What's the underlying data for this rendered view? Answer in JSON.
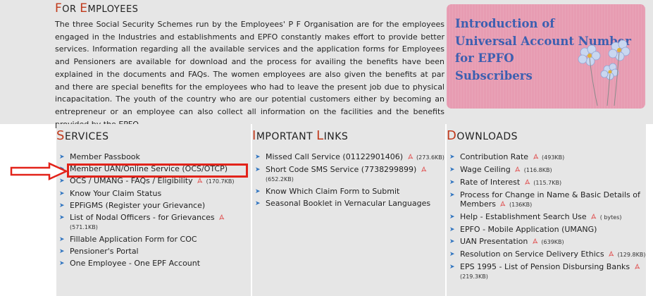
{
  "employees": {
    "title_first": "F",
    "title_rest_1": "OR ",
    "title_e": "E",
    "title_rest_2": "MPLOYEES",
    "text": "The three Social Security Schemes run by the Employees' P F Organisation are for the employees engaged in the Industries and establishments and EPFO constantly makes effort to provide better services. Information regarding all the available services and the application forms for Employees and Pensioners are available for download and the process for availing the benefits have been explained in the documents and FAQs. The women employees are also given the benefits at par and there are special benefits for the employees who had to leave the present job due to physical incapacitation. The youth of the country who are our potential customers either by becoming an entrepreneur or an employee can also collect all information on the facilities and the benefits provided by the EPFO."
  },
  "banner": {
    "line1": "Introduction of",
    "line2": "Universal Account Number",
    "line3": "for EPFO",
    "line4": "Subscribers",
    "text_color": "#3c5fb0",
    "bg_color": "#e79cb2"
  },
  "services": {
    "title_first": "S",
    "title_rest": "ERVICES",
    "items": [
      {
        "label": "Member Passbook"
      },
      {
        "label": "Member UAN/Online Service (OCS/OTCP)"
      },
      {
        "label": "OCS / UMANG - FAQs / Eligibility",
        "size": "(170.7KB)"
      },
      {
        "label": "Know Your Claim Status"
      },
      {
        "label": "EPFiGMS (Register your Grievance)"
      },
      {
        "label": "List of Nodal Officers - for Grievances",
        "size": "(571.1KB)"
      },
      {
        "label": "Fillable Application Form for COC"
      },
      {
        "label": "Pensioner's Portal"
      },
      {
        "label": "One Employee - One EPF Account"
      }
    ]
  },
  "links": {
    "title_first": "I",
    "title_mid": "MPORTANT ",
    "title_l": "L",
    "title_rest": "INKS",
    "items": [
      {
        "label": "Missed Call Service (01122901406)",
        "size": "(273.6KB)"
      },
      {
        "label": "Short Code SMS Service (7738299899)",
        "size": "(652.2KB)"
      },
      {
        "label": "Know Which Claim Form to Submit"
      },
      {
        "label": "Seasonal Booklet in Vernacular Languages"
      }
    ]
  },
  "downloads": {
    "title_first": "D",
    "title_rest": "OWNLOADS",
    "items": [
      {
        "label": "Contribution Rate",
        "size": "(493KB)"
      },
      {
        "label": "Wage Ceiling",
        "size": "(116.8KB)"
      },
      {
        "label": "Rate of Interest",
        "size": "(115.7KB)"
      },
      {
        "label": "Process for Change in Name & Basic Details of Members",
        "size": "(136KB)"
      },
      {
        "label": "Help - Establishment Search Use",
        "size": "( bytes)"
      },
      {
        "label": "EPFO - Mobile Application (UMANG)"
      },
      {
        "label": "UAN Presentation",
        "size": "(639KB)"
      },
      {
        "label": "Resolution on Service Delivery Ethics",
        "size": "(129.8KB)"
      },
      {
        "label": "EPS 1995 - List of Pension Disbursing Banks",
        "size": "(219.3KB)"
      }
    ]
  },
  "colors": {
    "accent_red": "#c0391b",
    "highlight_red": "#e2231a",
    "bullet_blue": "#2f74c0",
    "panel_gray": "#e6e6e6"
  }
}
